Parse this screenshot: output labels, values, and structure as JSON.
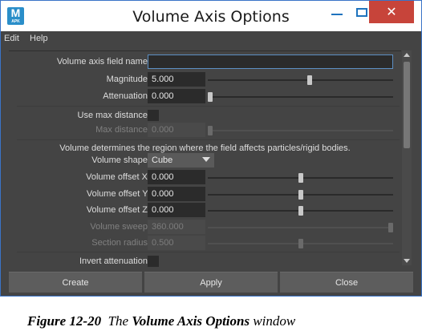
{
  "window": {
    "title": "Volume Axis Options",
    "app_icon_letter": "M",
    "app_icon_sub": "APK",
    "close_glyph": "✕"
  },
  "menu": [
    "Edit",
    "Help"
  ],
  "fields": {
    "name": {
      "label": "Volume axis field name:",
      "value": ""
    },
    "magnitude": {
      "label": "Magnitude:",
      "value": "5.000",
      "slider_fraction": 0.55
    },
    "attenuation": {
      "label": "Attenuation:",
      "value": "0.000",
      "slider_fraction": 0.0
    },
    "use_max_distance": {
      "label": "Use max distance:",
      "checked": false
    },
    "max_distance": {
      "label": "Max distance:",
      "value": "0.000",
      "slider_fraction": 0.0,
      "disabled": true
    },
    "info_text": "Volume determines the region where the field affects particles/rigid bodies.",
    "volume_shape": {
      "label": "Volume shape:",
      "value": "Cube"
    },
    "offset_x": {
      "label": "Volume offset X:",
      "value": "0.000",
      "slider_fraction": 0.5
    },
    "offset_y": {
      "label": "Volume offset Y:",
      "value": "0.000",
      "slider_fraction": 0.5
    },
    "offset_z": {
      "label": "Volume offset Z:",
      "value": "0.000",
      "slider_fraction": 0.5
    },
    "volume_sweep": {
      "label": "Volume sweep:",
      "value": "360.000",
      "slider_fraction": 1.0,
      "disabled": true
    },
    "section_radius": {
      "label": "Section radius:",
      "value": "0.500",
      "slider_fraction": 0.5,
      "disabled": true
    },
    "invert_attenuation": {
      "label": "Invert attenuation:",
      "checked": false
    }
  },
  "buttons": {
    "create": "Create",
    "apply": "Apply",
    "close": "Close"
  },
  "caption": {
    "figure": "Figure 12-20",
    "the": "The",
    "bold": "Volume Axis Options",
    "rest": "window"
  },
  "colors": {
    "background": "#444444",
    "field": "#2b2b2b",
    "button": "#5d5d5d",
    "close_button": "#c7443a",
    "accent": "#2a8ec9"
  }
}
